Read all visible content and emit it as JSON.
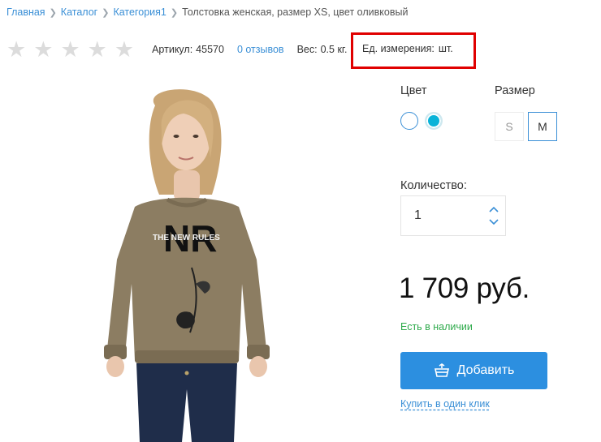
{
  "breadcrumb": {
    "items": [
      "Главная",
      "Каталог",
      "Категория1"
    ],
    "current": "Толстовка женская, размер XS, цвет оливковый"
  },
  "rating": {
    "stars_filled": 0,
    "stars_total": 5
  },
  "meta": {
    "article_label": "Артикул:",
    "article_value": "45570",
    "reviews_link": "0 отзывов",
    "weight_label": "Вес:",
    "weight_value": "0.5 кг.",
    "unit_label": "Ед. измерения:",
    "unit_value": "шт."
  },
  "product_image": {
    "print_text_big": "NR",
    "print_text_small": "THE NEW RULES"
  },
  "color": {
    "label": "Цвет",
    "options": [
      "#ffffff",
      "#0ab3d8"
    ]
  },
  "size": {
    "label": "Размер",
    "options": [
      "S",
      "M"
    ],
    "selected": "M"
  },
  "quantity": {
    "label": "Количество:",
    "value": "1"
  },
  "price": "1 709 руб.",
  "stock": "Есть в наличии",
  "buttons": {
    "add": "Добавить",
    "one_click": "Купить в один клик"
  },
  "colors": {
    "accent": "#2c8fe0",
    "link": "#3a8fd6",
    "in_stock": "#2eaa4b",
    "highlight": "#e00000"
  }
}
